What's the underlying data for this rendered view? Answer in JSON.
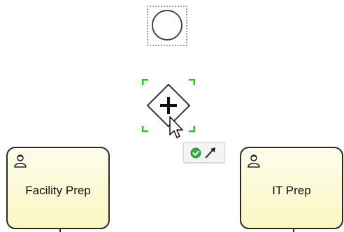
{
  "canvas": {
    "start_event": {
      "type": "start-event",
      "selected": true
    },
    "gateway": {
      "type": "parallel-gateway",
      "icon": "plus-icon",
      "selected": true,
      "selection_color": "#22cc22"
    },
    "context_pad": {
      "items": [
        {
          "name": "confirm-icon",
          "color": "#3aa84a"
        },
        {
          "name": "connect-arrow-icon",
          "color": "#222222"
        }
      ]
    },
    "tasks": [
      {
        "label": "Facility Prep",
        "icon": "user-icon"
      },
      {
        "label": "IT Prep",
        "icon": "user-icon"
      }
    ],
    "colors": {
      "task_fill": "#fbf6c2",
      "task_border": "#2a2a2a",
      "selection": "#22cc22"
    }
  }
}
